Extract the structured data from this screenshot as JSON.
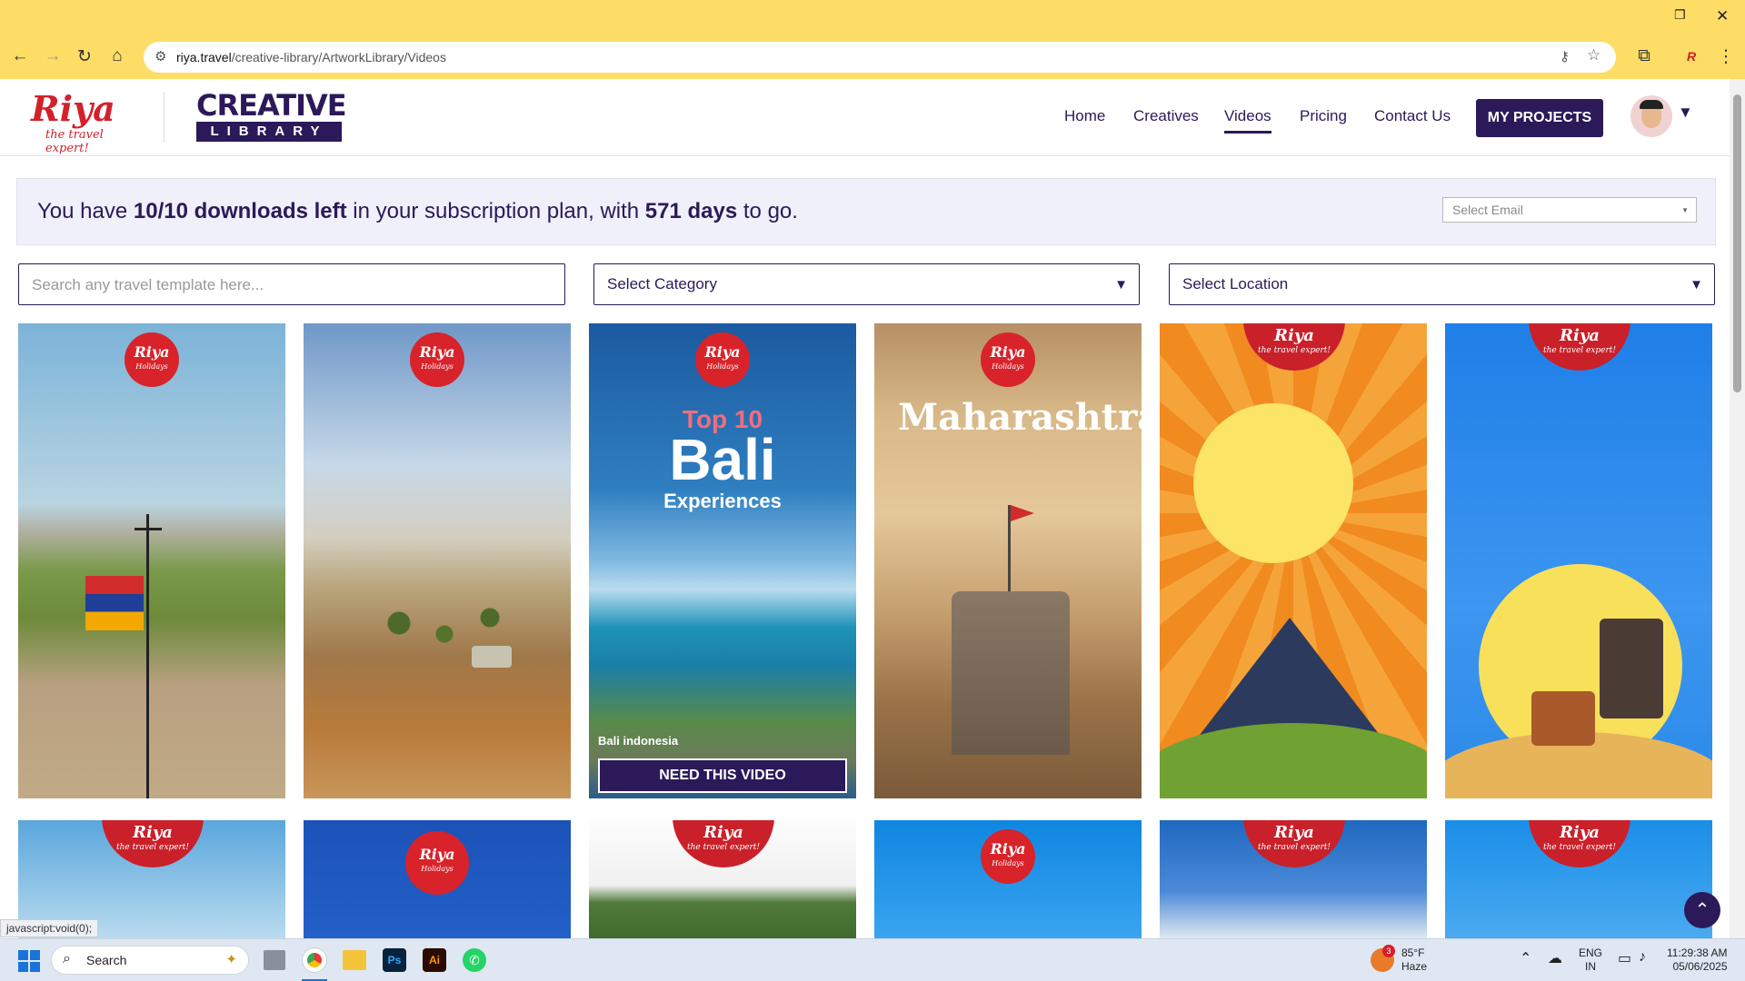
{
  "browser": {
    "url_domain": "riya.travel",
    "url_path": "/creative-library/ArtworkLibrary/Videos"
  },
  "site": {
    "brand_name": "Riya",
    "brand_tagline": "the travel expert!",
    "library_top": "CREATIVE",
    "library_bottom": "LIBRARY",
    "nav": [
      "Home",
      "Creatives",
      "Videos",
      "Pricing",
      "Contact Us"
    ],
    "active_nav": "Videos",
    "projects_label": "MY PROJECTS"
  },
  "banner": {
    "pre": "You have ",
    "downloads": "10/10 downloads left",
    "mid": " in your subscription plan, with ",
    "days": "571 days",
    "post": " to go.",
    "email_placeholder": "Select Email"
  },
  "filters": {
    "search_placeholder": "Search any travel template here...",
    "category": "Select Category",
    "location": "Select Location"
  },
  "watermarks": {
    "holidays_name": "Riya",
    "holidays_sub": "Holidays",
    "expert_name": "Riya",
    "expert_sub": "the travel expert!"
  },
  "cards": {
    "bali": {
      "line1": "Top 10",
      "line2": "Bali",
      "line3": "Experiences",
      "caption": "Bali indonesia",
      "button": "NEED THIS VIDEO"
    },
    "maharashtra": {
      "title": "Maharashtra"
    }
  },
  "status_bar": "javascript:void(0);",
  "taskbar": {
    "search": "Search",
    "temp": "85°F",
    "weather": "Haze",
    "weather_badge": "3",
    "lang1": "ENG",
    "lang2": "IN",
    "time": "11:29:38 AM",
    "date": "05/06/2025"
  }
}
